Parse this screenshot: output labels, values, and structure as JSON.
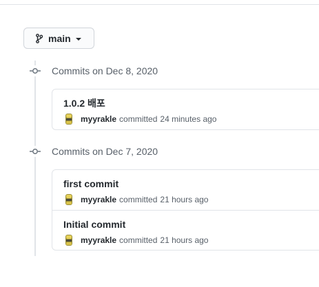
{
  "branch": {
    "name": "main",
    "icon": "git-branch-icon"
  },
  "groups": [
    {
      "title": "Commits on Dec 8, 2020",
      "commits": [
        {
          "message": "1.0.2 배포",
          "author": "myyrakle",
          "action": "committed",
          "time": "24 minutes ago"
        }
      ]
    },
    {
      "title": "Commits on Dec 7, 2020",
      "commits": [
        {
          "message": "first commit",
          "author": "myyrakle",
          "action": "committed",
          "time": "21 hours ago"
        },
        {
          "message": "Initial commit",
          "author": "myyrakle",
          "action": "committed",
          "time": "21 hours ago"
        }
      ]
    }
  ],
  "colors": {
    "border": "#e1e4e8",
    "muted_text": "#586069",
    "text": "#24292e"
  }
}
